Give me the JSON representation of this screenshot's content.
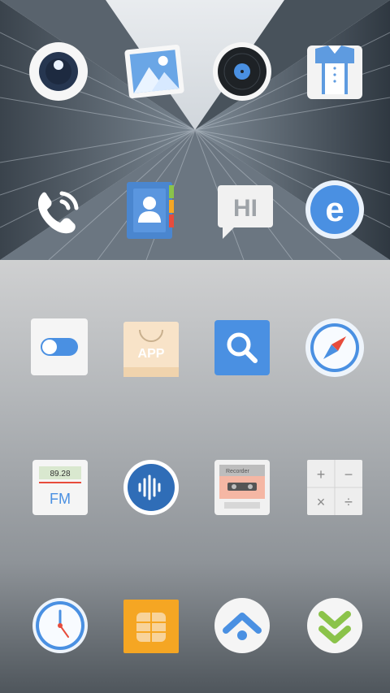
{
  "home_screen": {
    "row1": [
      {
        "name": "camera"
      },
      {
        "name": "gallery"
      },
      {
        "name": "music",
        "label": "Music"
      },
      {
        "name": "theme"
      }
    ],
    "row2": [
      {
        "name": "phone"
      },
      {
        "name": "contacts"
      },
      {
        "name": "messages",
        "label": "HI"
      },
      {
        "name": "browser",
        "label": "e"
      }
    ],
    "row3": [
      {
        "name": "settings"
      },
      {
        "name": "app-store",
        "label": "APP"
      },
      {
        "name": "search"
      },
      {
        "name": "compass"
      }
    ],
    "row4": [
      {
        "name": "fm-radio",
        "label": "FM",
        "frequency": "89.28"
      },
      {
        "name": "voice-recorder"
      },
      {
        "name": "recorder",
        "label": "Recorder"
      },
      {
        "name": "calculator",
        "symbols": [
          "+",
          "−",
          "×",
          "÷"
        ]
      }
    ],
    "row5": [
      {
        "name": "clock"
      },
      {
        "name": "sim-toolkit"
      },
      {
        "name": "updater"
      },
      {
        "name": "downloads"
      }
    ]
  },
  "colors": {
    "accent_blue": "#4a90e2",
    "orange": "#f5a623",
    "green": "#8bc34a"
  }
}
